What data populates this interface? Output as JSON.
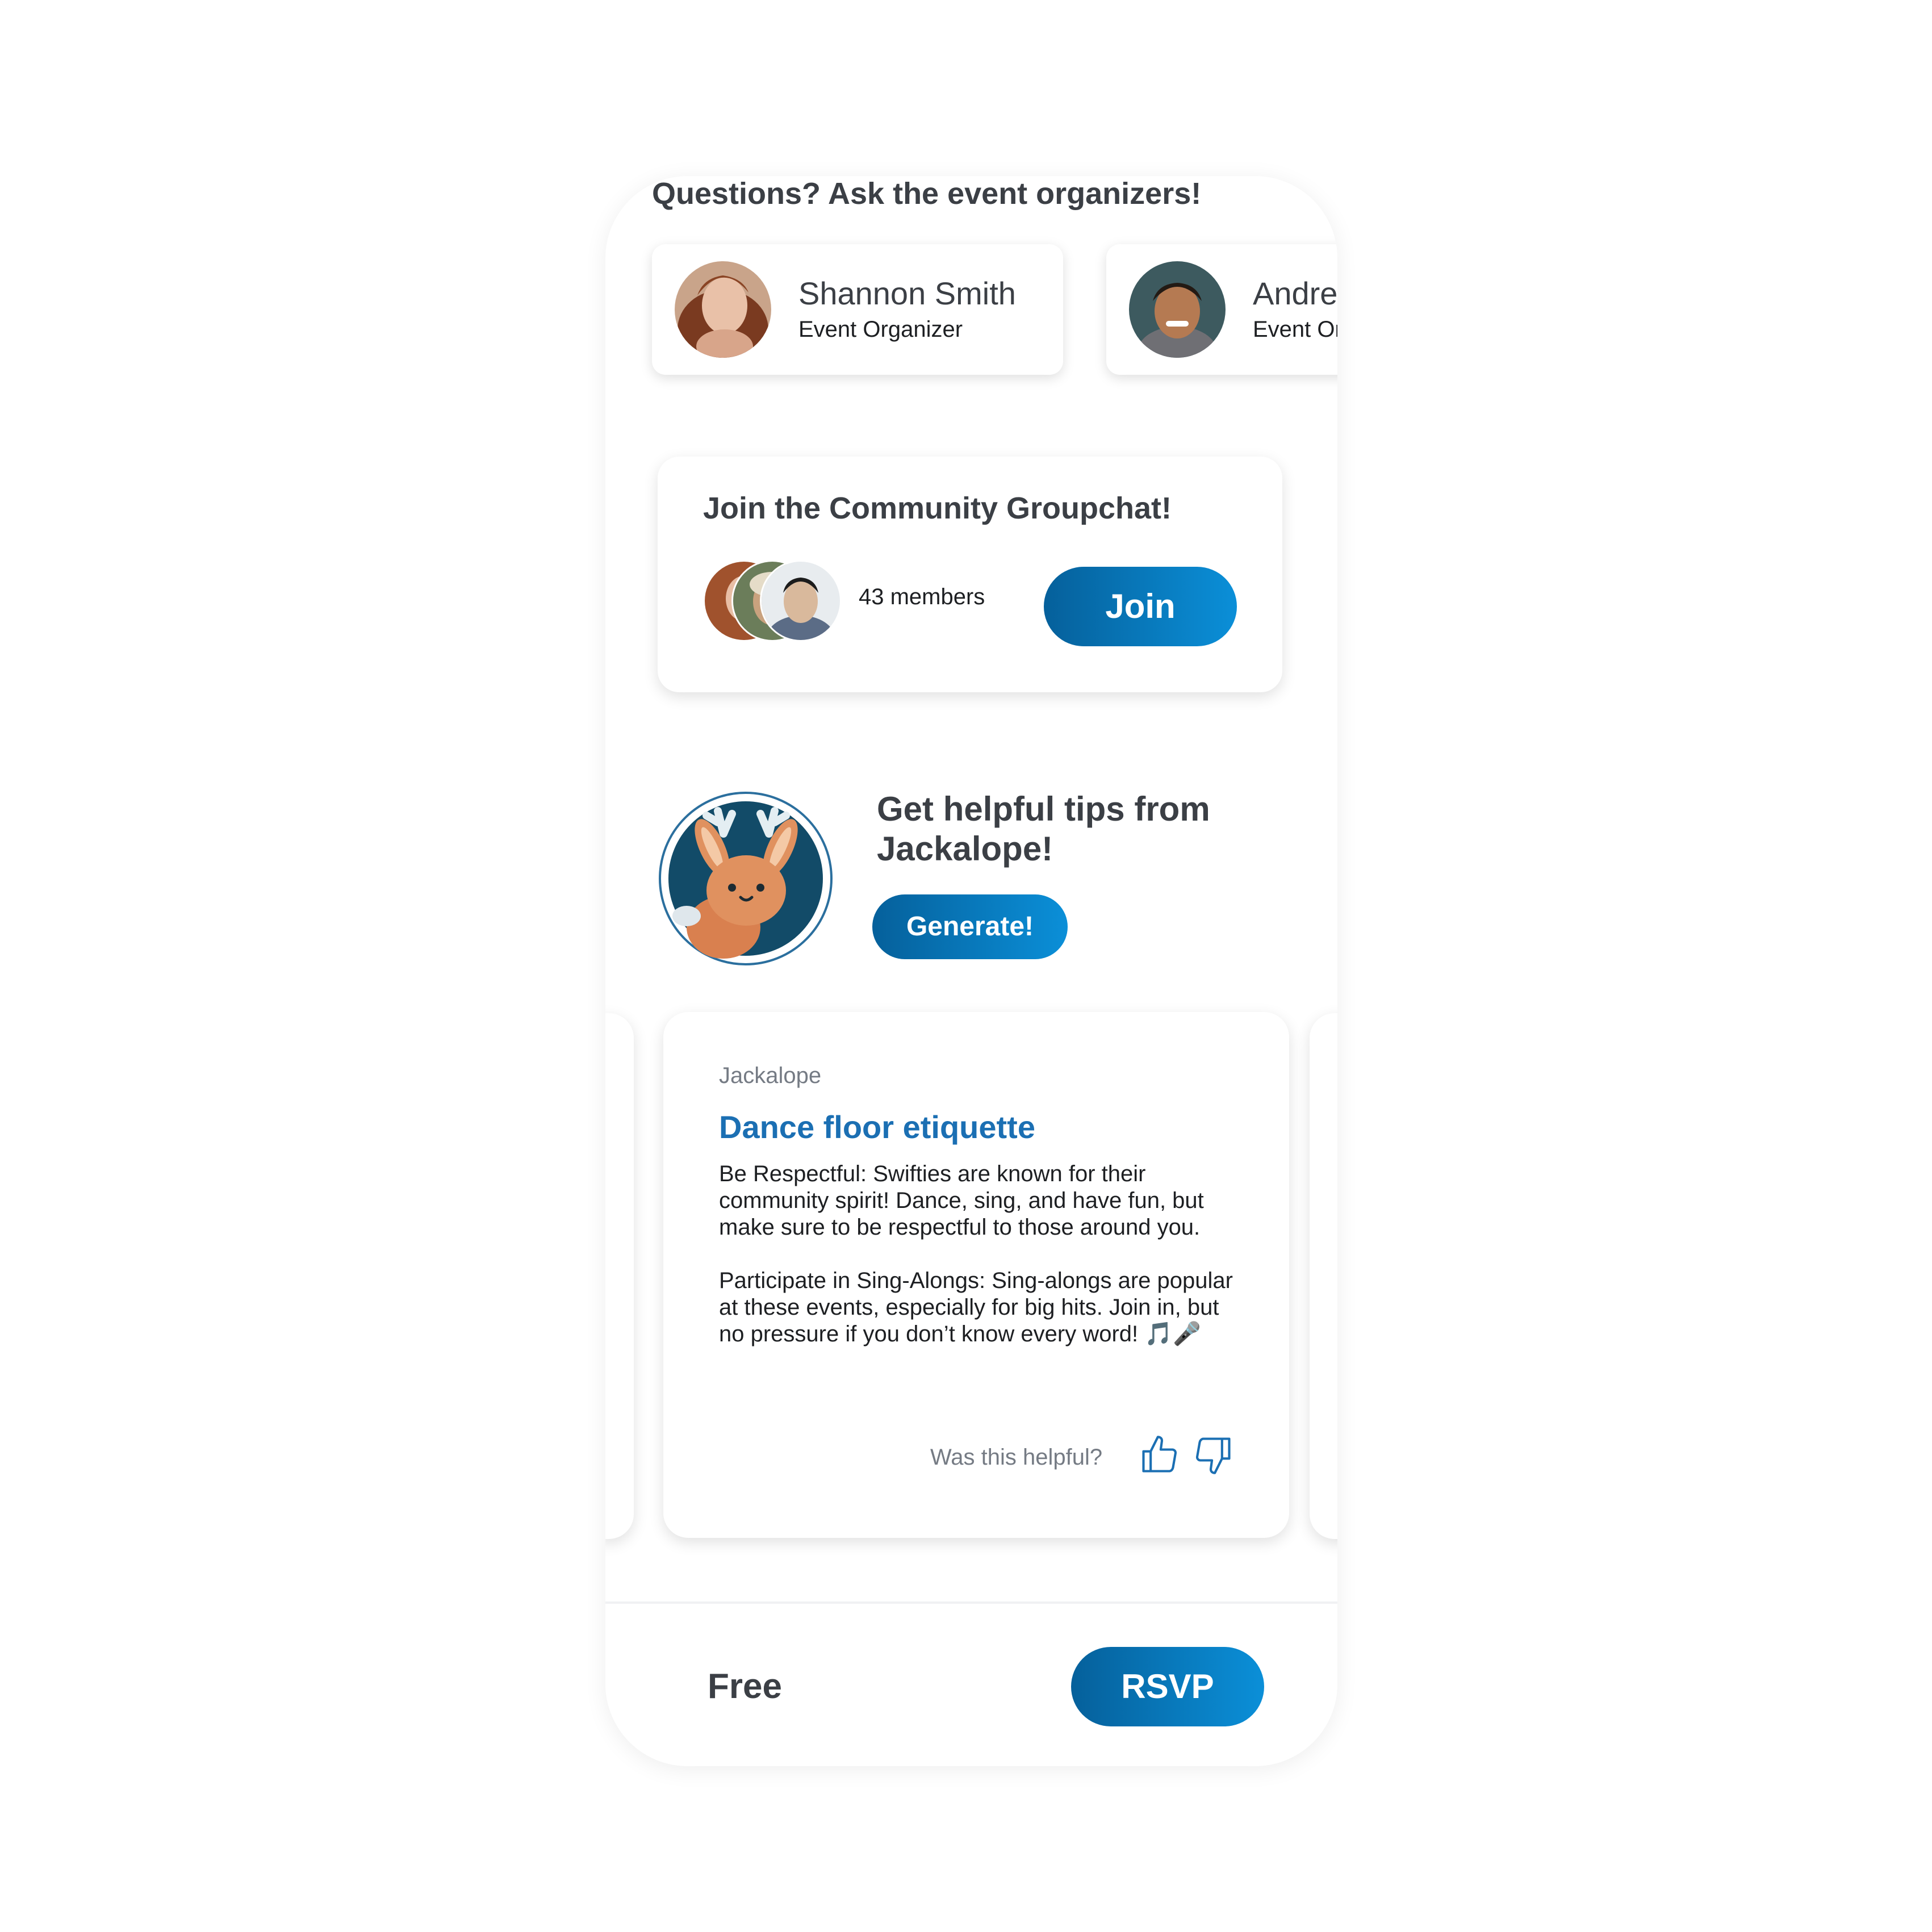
{
  "organizers": {
    "title": "Questions? Ask the event organizers!",
    "items": [
      {
        "name": "Shannon Smith",
        "role": "Event Organizer"
      },
      {
        "name": "Andre",
        "role": "Event Or"
      }
    ]
  },
  "groupchat": {
    "title": "Join the Community Groupchat!",
    "members": "43 members",
    "join_label": "Join"
  },
  "tips": {
    "title": "Get helpful tips from Jackalope!",
    "generate_label": "Generate!",
    "card": {
      "source": "Jackalope",
      "heading": "Dance floor etiquette",
      "paragraph1": "Be Respectful: Swifties are known for their community spirit! Dance, sing, and have fun, but make sure to be respectful to those around you.",
      "paragraph2": "Participate in Sing-Alongs: Sing-alongs are popular at these events, especially for big hits. Join in, but no pressure if you don’t know every word! 🎵🎤",
      "feedback_prompt": "Was this helpful?"
    }
  },
  "footer": {
    "price": "Free",
    "rsvp_label": "RSVP"
  },
  "colors": {
    "accent_start": "#05609b",
    "accent_end": "#0b8fd8",
    "heading_blue": "#1b6fb3",
    "text_dark": "#3b3f45"
  },
  "icons": [
    "thumbs-up-icon",
    "thumbs-down-icon",
    "jackalope-mascot"
  ]
}
